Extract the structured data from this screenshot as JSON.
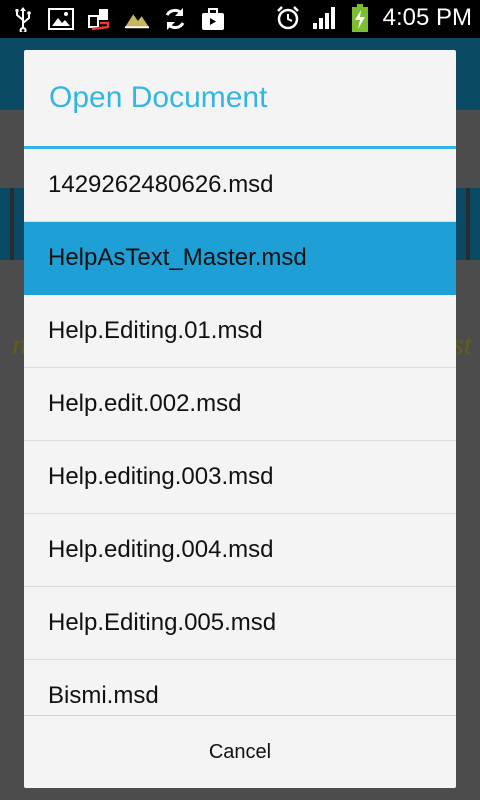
{
  "status_bar": {
    "time": "4:05 PM",
    "icons": [
      "usb-icon",
      "image-icon",
      "data-transfer-icon",
      "landscape-icon",
      "sync-icon",
      "briefcase-icon",
      "alarm-icon",
      "signal-icon",
      "battery-charging-icon"
    ],
    "battery_color": "#7dbd32"
  },
  "background_app": {
    "bar_color": "#0b4a64",
    "italic_left": "n",
    "italic_right": "st"
  },
  "dialog": {
    "title": "Open Document",
    "accent_color": "#33b5e5",
    "selected_color": "#1ea0d6",
    "files": [
      {
        "name": "1429262480626.msd",
        "selected": false
      },
      {
        "name": "HelpAsText_Master.msd",
        "selected": true
      },
      {
        "name": "Help.Editing.01.msd",
        "selected": false
      },
      {
        "name": "Help.edit.002.msd",
        "selected": false
      },
      {
        "name": "Help.editing.003.msd",
        "selected": false
      },
      {
        "name": "Help.editing.004.msd",
        "selected": false
      },
      {
        "name": "Help.Editing.005.msd",
        "selected": false
      },
      {
        "name": "Bismi.msd",
        "selected": false
      }
    ],
    "cancel_label": "Cancel"
  }
}
